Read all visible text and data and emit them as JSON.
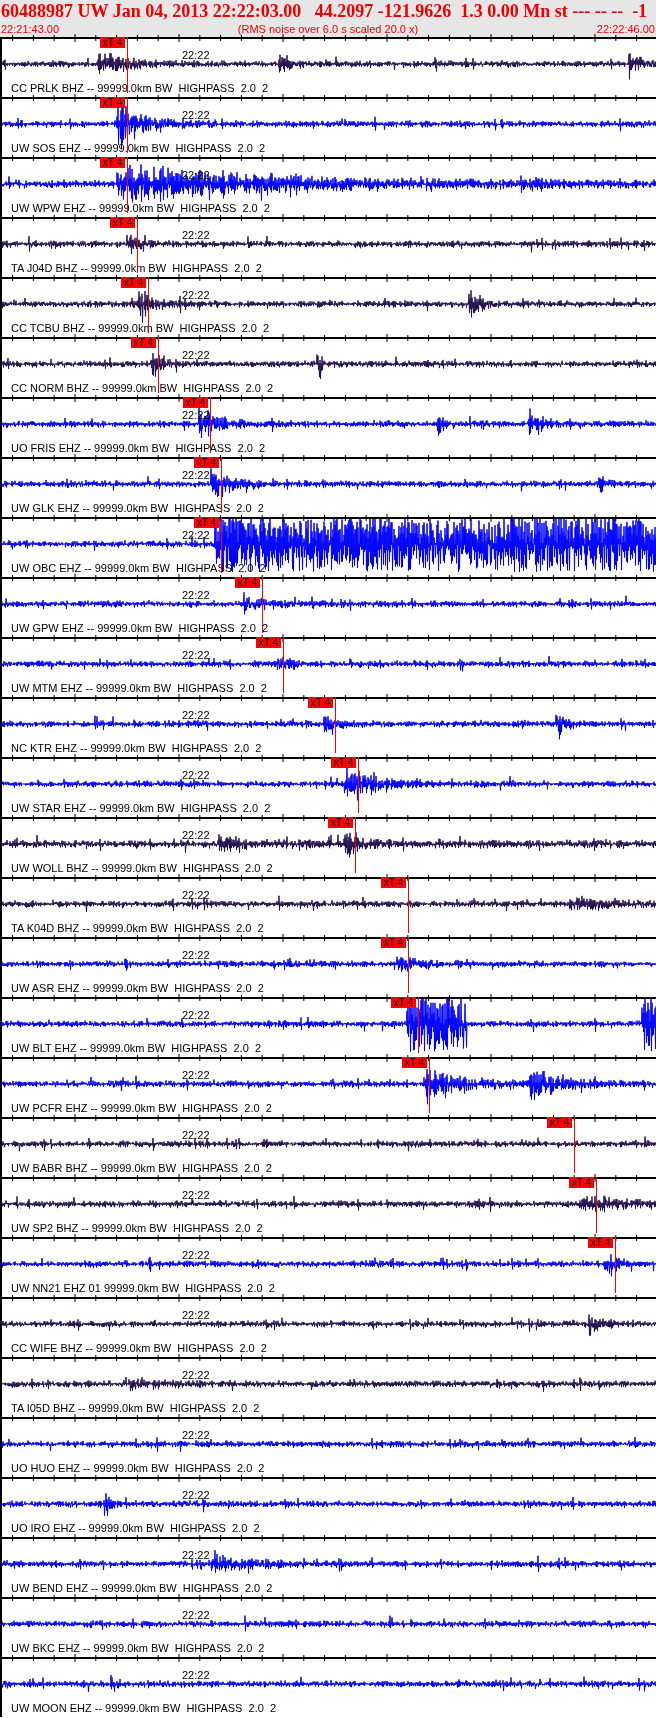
{
  "header": {
    "title": "60488987 UW Jan 04, 2013 22:22:03.00   44.2097 -121.9626  1.3 0.00 Mn st --- -- --  -1",
    "start_time": "22:21:43.00",
    "scale_note": "(RMS noise over 6.0 s scaled 20.0 x)",
    "end_time": "22:22:46.00"
  },
  "traces": [
    {
      "label": "CC PRLK BHZ -- 99999.0km BW  HIGHPASS  2.0  2",
      "tick_label": "22:22",
      "color": "#22104f",
      "pick": "xT 4"
    },
    {
      "label": "UW SOS EHZ -- 99999.0km BW  HIGHPASS  2.0  2",
      "tick_label": "22:22",
      "color": "#0000ff",
      "pick": "xT 4"
    },
    {
      "label": "UW WPW EHZ -- 99999.0km BW  HIGHPASS  2.0  2",
      "tick_label": "22:22",
      "color": "#0000ff",
      "pick": "xT 4"
    },
    {
      "label": "TA J04D BHZ -- 99999.0km BW  HIGHPASS  2.0  2",
      "tick_label": "22:22",
      "color": "#22104f",
      "pick": "xT 4"
    },
    {
      "label": "CC TCBU BHZ -- 99999.0km BW  HIGHPASS  2.0  2",
      "tick_label": "22:22",
      "color": "#22104f",
      "pick": "xT 4"
    },
    {
      "label": "CC NORM BHZ -- 99999.0km BW  HIGHPASS  2.0  2",
      "tick_label": "22:22",
      "color": "#22104f",
      "pick": "xT 4"
    },
    {
      "label": "UO FRIS EHZ -- 99999.0km BW  HIGHPASS  2.0  2",
      "tick_label": "22:22",
      "color": "#0000ff",
      "pick": "xT 4"
    },
    {
      "label": "UW GLK EHZ -- 99999.0km BW  HIGHPASS  2.0  2",
      "tick_label": "22:22",
      "color": "#0000ff",
      "pick": "xT 4"
    },
    {
      "label": "UW OBC EHZ -- 99999.0km BW  HIGHPASS  2.0  2",
      "tick_label": "22:22",
      "color": "#0000ff",
      "pick": "xT 4"
    },
    {
      "label": "UW GPW EHZ -- 99999.0km BW  HIGHPASS  2.0  2",
      "tick_label": "22:22",
      "color": "#0000ff",
      "pick": "xT 4"
    },
    {
      "label": "UW MTM EHZ -- 99999.0km BW  HIGHPASS  2.0  2",
      "tick_label": "22:22",
      "color": "#0000ff",
      "pick": "xT 4"
    },
    {
      "label": "NC KTR EHZ -- 99999.0km BW  HIGHPASS  2.0  2",
      "tick_label": "22:22",
      "color": "#0000ff",
      "pick": "xT 4"
    },
    {
      "label": "UW STAR EHZ -- 99999.0km BW  HIGHPASS  2.0  2",
      "tick_label": "22:22",
      "color": "#0000ff",
      "pick": "xT 4"
    },
    {
      "label": "UW WOLL BHZ -- 99999.0km BW  HIGHPASS  2.0  2",
      "tick_label": "22:22",
      "color": "#22104f",
      "pick": "xT 4"
    },
    {
      "label": "TA K04D BHZ -- 99999.0km BW  HIGHPASS  2.0  2",
      "tick_label": "22:22",
      "color": "#22104f",
      "pick": "xT 4"
    },
    {
      "label": "UW ASR EHZ -- 99999.0km BW  HIGHPASS  2.0  2",
      "tick_label": "22:22",
      "color": "#0000ff",
      "pick": "xT 4"
    },
    {
      "label": "UW BLT EHZ -- 99999.0km BW  HIGHPASS  2.0  2",
      "tick_label": "22:22",
      "color": "#0000ff",
      "pick": "xT 4"
    },
    {
      "label": "UW PCFR EHZ -- 99999.0km BW  HIGHPASS  2.0  2",
      "tick_label": "22:22",
      "color": "#0000ff",
      "pick": "xT 4"
    },
    {
      "label": "UW BABR BHZ -- 99999.0km BW  HIGHPASS  2.0  2",
      "tick_label": "22:22",
      "color": "#22104f",
      "pick": "xT 4"
    },
    {
      "label": "UW SP2 BHZ -- 99999.0km BW  HIGHPASS  2.0  2",
      "tick_label": "22:22",
      "color": "#22104f",
      "pick": "xT 4"
    },
    {
      "label": "UW NN21 EHZ 01 99999.0km BW  HIGHPASS  2.0  2",
      "tick_label": "22:22",
      "color": "#0000ff",
      "pick": "xT 4"
    },
    {
      "label": "CC WIFE BHZ -- 99999.0km BW  HIGHPASS  2.0  2",
      "tick_label": "22:22",
      "color": "#22104f"
    },
    {
      "label": "TA I05D BHZ -- 99999.0km BW  HIGHPASS  2.0  2",
      "tick_label": "22:22",
      "color": "#22104f"
    },
    {
      "label": "UO HUO EHZ -- 99999.0km BW  HIGHPASS  2.0  2",
      "tick_label": "22:22",
      "color": "#0000ff"
    },
    {
      "label": "UO IRO EHZ -- 99999.0km BW  HIGHPASS  2.0  2",
      "tick_label": "22:22",
      "color": "#0000ff"
    },
    {
      "label": "UW BEND EHZ -- 99999.0km BW  HIGHPASS  2.0  2",
      "tick_label": "22:22",
      "color": "#0000ff"
    },
    {
      "label": "UW BKC EHZ -- 99999.0km BW  HIGHPASS  2.0  2",
      "tick_label": "22:22",
      "color": "#0000ff"
    },
    {
      "label": "UW MOON EHZ -- 99999.0km BW  HIGHPASS  2.0  2",
      "tick_label": "22:22",
      "color": "#0000ff"
    }
  ]
}
